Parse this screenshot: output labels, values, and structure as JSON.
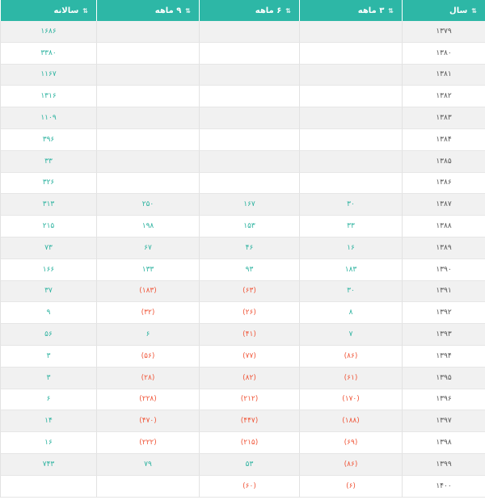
{
  "header": {
    "year_label": "سال",
    "m3_label": "۳ ماهه",
    "m6_label": "۶ ماهه",
    "m9_label": "۹ ماهه",
    "annual_label": "سالانه",
    "sort_icon": "sort-arrows-icon",
    "bg_color": "#2db7a6"
  },
  "colors": {
    "positive": "#2eb3a0",
    "negative": "#f0573a"
  },
  "rows": [
    {
      "year": "۱۳۷۹",
      "m3": "",
      "m6": "",
      "m9": "",
      "annual": "۱۶۸۶"
    },
    {
      "year": "۱۳۸۰",
      "m3": "",
      "m6": "",
      "m9": "",
      "annual": "۳۳۸۰"
    },
    {
      "year": "۱۳۸۱",
      "m3": "",
      "m6": "",
      "m9": "",
      "annual": "۱۱۶۷"
    },
    {
      "year": "۱۳۸۲",
      "m3": "",
      "m6": "",
      "m9": "",
      "annual": "۱۳۱۶"
    },
    {
      "year": "۱۳۸۳",
      "m3": "",
      "m6": "",
      "m9": "",
      "annual": "۱۱۰۹"
    },
    {
      "year": "۱۳۸۴",
      "m3": "",
      "m6": "",
      "m9": "",
      "annual": "۳۹۶"
    },
    {
      "year": "۱۳۸۵",
      "m3": "",
      "m6": "",
      "m9": "",
      "annual": "۳۳"
    },
    {
      "year": "۱۳۸۶",
      "m3": "",
      "m6": "",
      "m9": "",
      "annual": "۳۲۶"
    },
    {
      "year": "۱۳۸۷",
      "m3": "۳۰",
      "m6": "۱۶۷",
      "m9": "۲۵۰",
      "annual": "۳۱۳"
    },
    {
      "year": "۱۳۸۸",
      "m3": "۳۳",
      "m6": "۱۵۳",
      "m9": "۱۹۸",
      "annual": "۲۱۵"
    },
    {
      "year": "۱۳۸۹",
      "m3": "۱۶",
      "m6": "۴۶",
      "m9": "۶۷",
      "annual": "۷۳"
    },
    {
      "year": "۱۳۹۰",
      "m3": "۱۸۳",
      "m6": "۹۳",
      "m9": "۱۳۳",
      "annual": "۱۶۶"
    },
    {
      "year": "۱۳۹۱",
      "m3": "۳۰",
      "m6": "(۶۳)",
      "m9": "(۱۸۳)",
      "annual": "۳۷"
    },
    {
      "year": "۱۳۹۲",
      "m3": "۸",
      "m6": "(۲۶)",
      "m9": "(۳۲)",
      "annual": "۹"
    },
    {
      "year": "۱۳۹۳",
      "m3": "۷",
      "m6": "(۴۱)",
      "m9": "۶",
      "annual": "۵۶"
    },
    {
      "year": "۱۳۹۴",
      "m3": "(۸۶)",
      "m6": "(۷۷)",
      "m9": "(۵۶)",
      "annual": "۳"
    },
    {
      "year": "۱۳۹۵",
      "m3": "(۶۱)",
      "m6": "(۸۲)",
      "m9": "(۲۸)",
      "annual": "۳"
    },
    {
      "year": "۱۳۹۶",
      "m3": "(۱۷۰)",
      "m6": "(۲۱۲)",
      "m9": "(۲۲۸)",
      "annual": "۶"
    },
    {
      "year": "۱۳۹۷",
      "m3": "(۱۸۸)",
      "m6": "(۴۴۷)",
      "m9": "(۴۷۰)",
      "annual": "۱۴"
    },
    {
      "year": "۱۳۹۸",
      "m3": "(۶۹)",
      "m6": "(۲۱۵)",
      "m9": "(۲۲۲)",
      "annual": "۱۶"
    },
    {
      "year": "۱۳۹۹",
      "m3": "(۸۶)",
      "m6": "۵۳",
      "m9": "۷۹",
      "annual": "۷۴۳"
    },
    {
      "year": "۱۴۰۰",
      "m3": "(۶)",
      "m6": "(۶۰)",
      "m9": "",
      "annual": ""
    }
  ]
}
